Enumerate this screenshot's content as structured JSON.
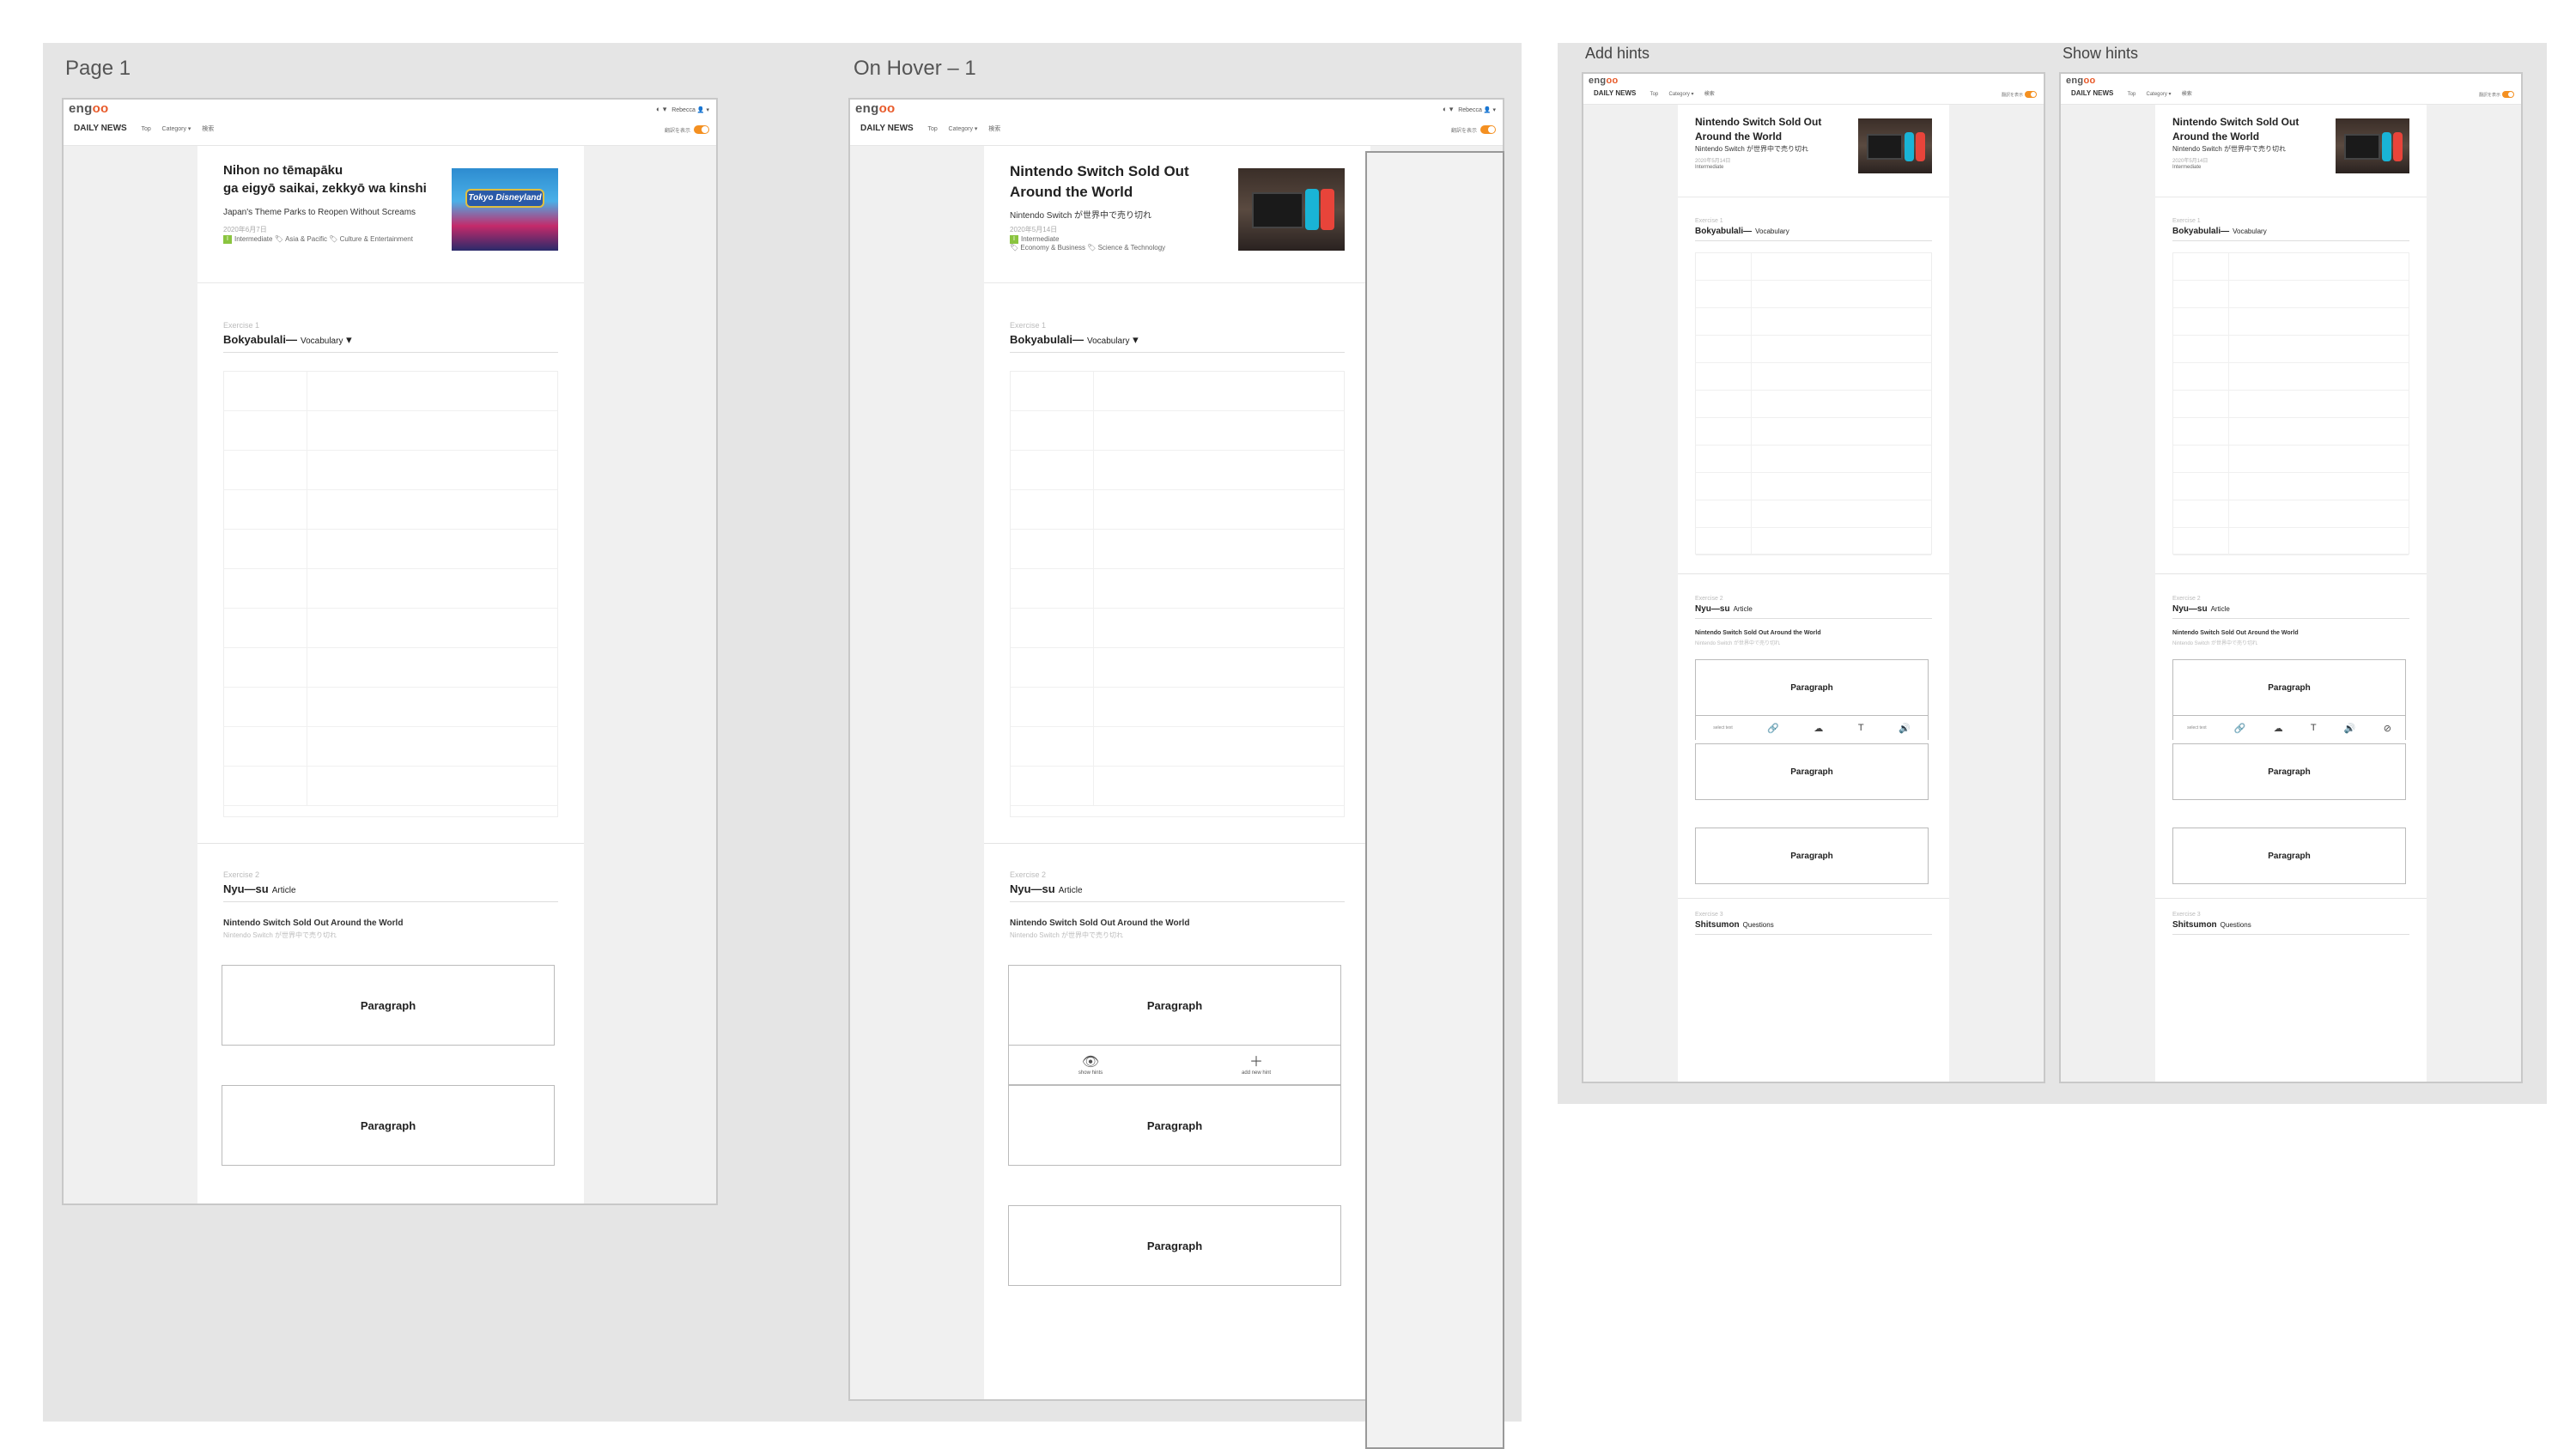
{
  "frames": {
    "page1_label": "Page 1",
    "hover_label": "On Hover – 1",
    "add_hints_label": "Add hints",
    "show_hints_label": "Show hints"
  },
  "app": {
    "logo_prefix": "eng",
    "logo_suffix": "oo",
    "brand": "DAILY NEWS",
    "nav": [
      "Top",
      "Category ▾",
      "検索"
    ],
    "lang": "◐ ▾",
    "user": "Rebecca",
    "user_icon": "👤 ▾",
    "toggle_label": "翻訳を表示"
  },
  "page1": {
    "hero": {
      "title_line1": "Nihon no tēmapāku",
      "title_line2": "ga eigyō saikai, zekkyō wa kinshi",
      "subtitle": "Japan's Theme Parks to Reopen Without Screams",
      "date": "2020年6月7日",
      "level": "Intermediate",
      "tags": "Asia & Pacific  🏷 Culture & Entertainment",
      "image_sign": "Tokyo Disneyland"
    }
  },
  "hover": {
    "hero": {
      "title_line1": "Nintendo Switch Sold Out",
      "title_line2": "Around the World",
      "subtitle": "Nintendo Switch が世界中で売り切れ",
      "date": "2020年5月14日",
      "level": "Intermediate",
      "tags": "Economy & Business  🏷 Science & Technology"
    },
    "show_hints": "show hints",
    "add_new_hint": "add new hint"
  },
  "exercises": {
    "ex1_label": "Exercise 1",
    "ex1_title": "Bokyabulali—",
    "ex1_sub": "Vocabulary",
    "ex2_label": "Exercise 2",
    "ex2_title": "Nyu—su",
    "ex2_sub": "Article",
    "ex3_label": "Exercise 3",
    "ex3_title": "Shitsumon",
    "ex3_sub": "Questions",
    "article_title": "Nintendo Switch Sold Out Around the World",
    "article_sub": "Nintendo Switch が世界中で売り切れ",
    "paragraph": "Paragraph"
  },
  "toolbar": {
    "label": "select text",
    "icons": [
      "🔗",
      "☁",
      "T",
      "🔊"
    ],
    "extra_icon": "⊘"
  }
}
